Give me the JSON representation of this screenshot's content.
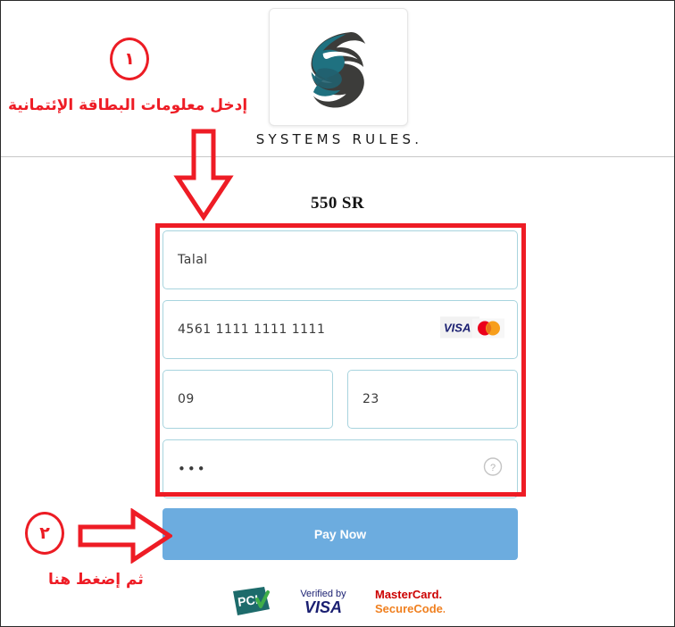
{
  "header": {
    "logo_icon": "systems-rules-swirl-logo",
    "logo_colors": {
      "teal": "#1f7180",
      "dark": "#3a3a38"
    },
    "brand_name": "SYSTEMS RULES."
  },
  "payment": {
    "amount": "550 SR",
    "fields": [
      {
        "name": "cardholder-name",
        "value": "Talal",
        "masked": false
      },
      {
        "name": "card-number",
        "value": "4561 1111 1111 1111",
        "masked": false
      },
      {
        "name": "expiry-month",
        "value": "09",
        "masked": false
      },
      {
        "name": "expiry-year",
        "value": "23",
        "masked": false
      },
      {
        "name": "cvv",
        "value": "•••",
        "masked": true
      }
    ],
    "card_brand_icons": [
      "visa-icon",
      "mastercard-icon"
    ],
    "cvv_help_icon": "question-mark-circle-icon",
    "pay_button_label": "Pay Now",
    "pay_button_color": "#6cacdf"
  },
  "footer": {
    "badges": [
      {
        "name": "pci-compliance-badge",
        "text": "PCI"
      },
      {
        "name": "verified-by-visa-badge",
        "line1": "Verified by",
        "line2": "VISA"
      },
      {
        "name": "mastercard-securecode-badge",
        "line1": "MasterCard.",
        "line2": "SecureCode."
      }
    ]
  },
  "annotations": {
    "color": "#ee1c25",
    "step1_number": "١",
    "step1_text": "إدخل معلومات البطاقة الإئتمانية",
    "step2_number": "٢",
    "step2_text": "ثم إضغط هنا",
    "arrow_down_icon": "arrow-down-outline-icon",
    "arrow_right_icon": "arrow-right-outline-icon",
    "highlight_box_icon": "red-highlight-rectangle"
  }
}
